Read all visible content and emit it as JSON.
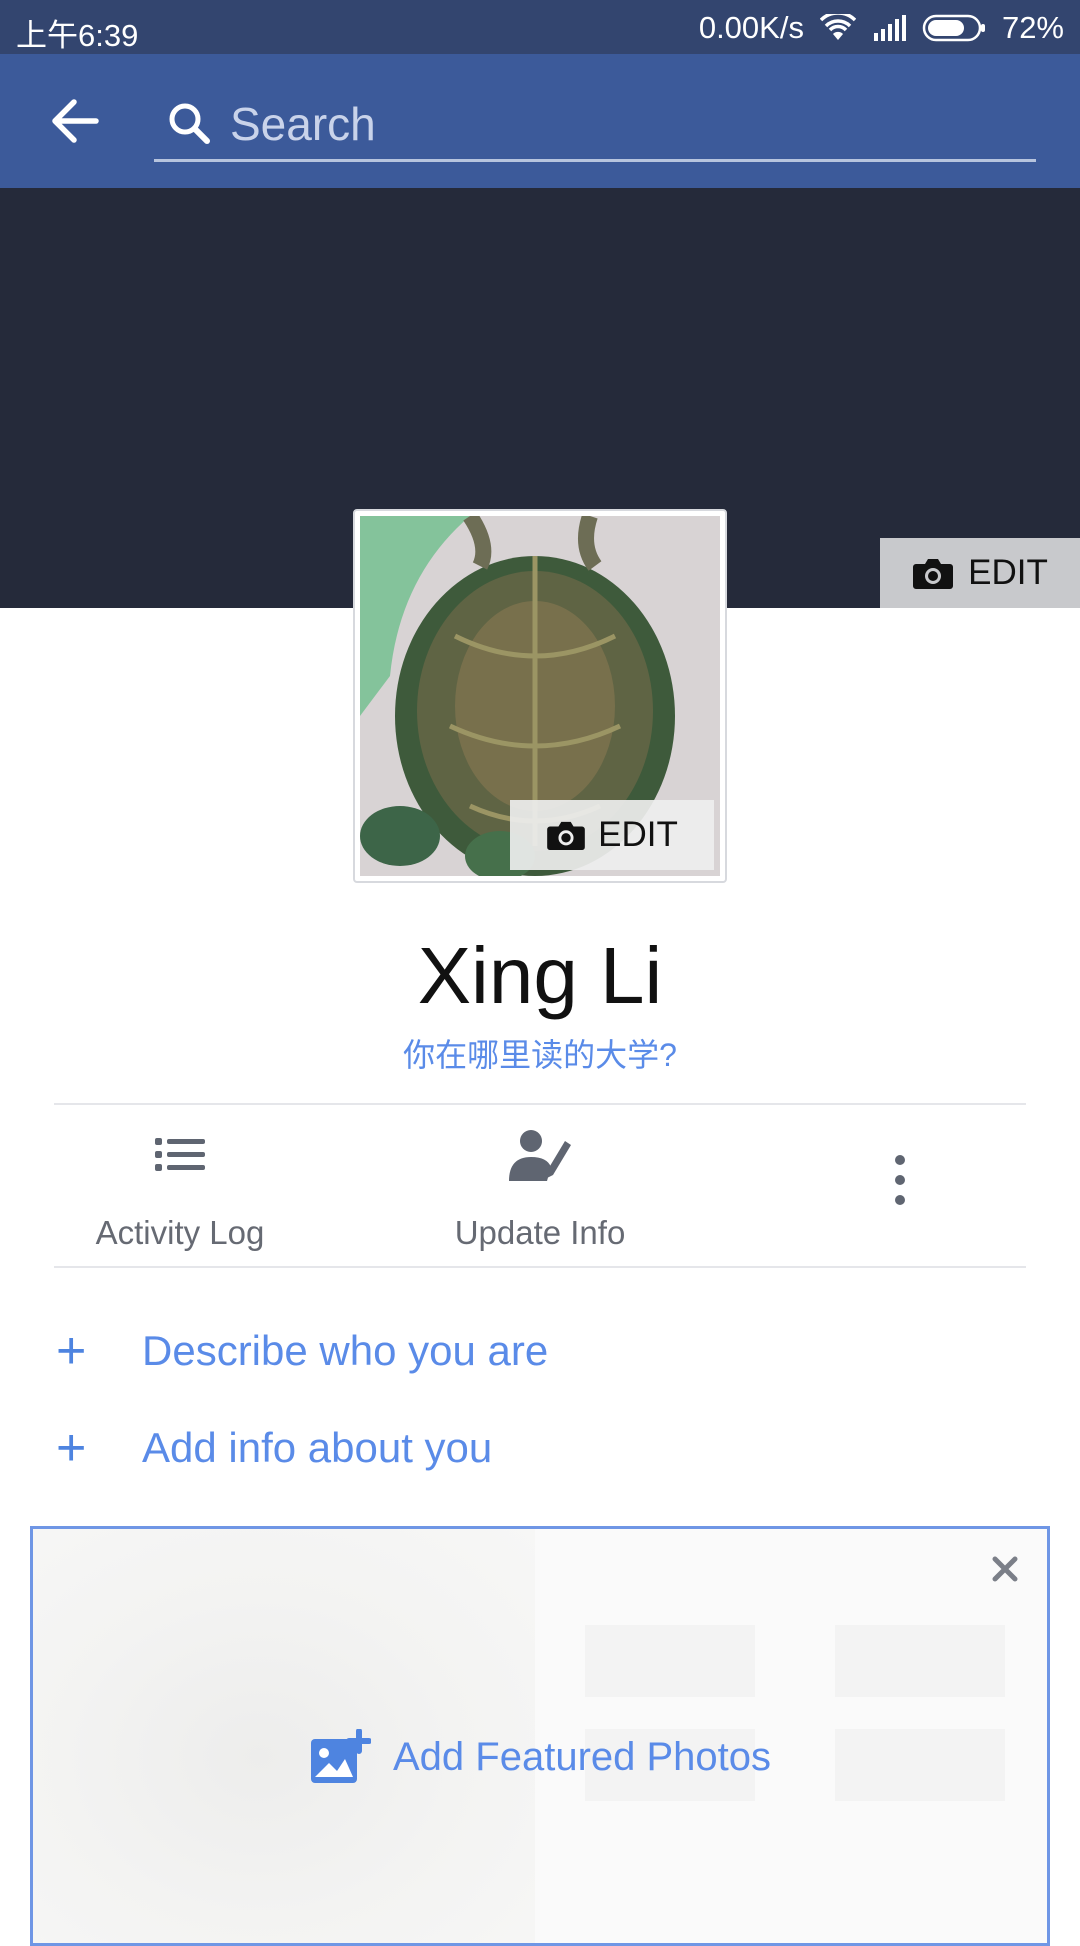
{
  "status_bar": {
    "time": "上午6:39",
    "net_speed": "0.00K/s",
    "battery": "72%"
  },
  "search": {
    "placeholder": "Search"
  },
  "cover": {
    "edit_label": "EDIT"
  },
  "avatar": {
    "edit_label": "EDIT"
  },
  "profile": {
    "name": "Xing Li",
    "school_prompt": "你在哪里读的大学?"
  },
  "actions": [
    {
      "label": "Activity Log",
      "icon": "list-icon"
    },
    {
      "label": "Update Info",
      "icon": "person-edit-icon"
    },
    {
      "label": "",
      "icon": "more-vertical-icon"
    }
  ],
  "intro": {
    "describe": "Describe who you are",
    "add_info": "Add info about you"
  },
  "featured": {
    "label": "Add Featured Photos"
  },
  "colors": {
    "status_bar": "#33456f",
    "app_bar": "#3c5a9a",
    "cover": "#252a3a",
    "link": "#5a8be8"
  }
}
